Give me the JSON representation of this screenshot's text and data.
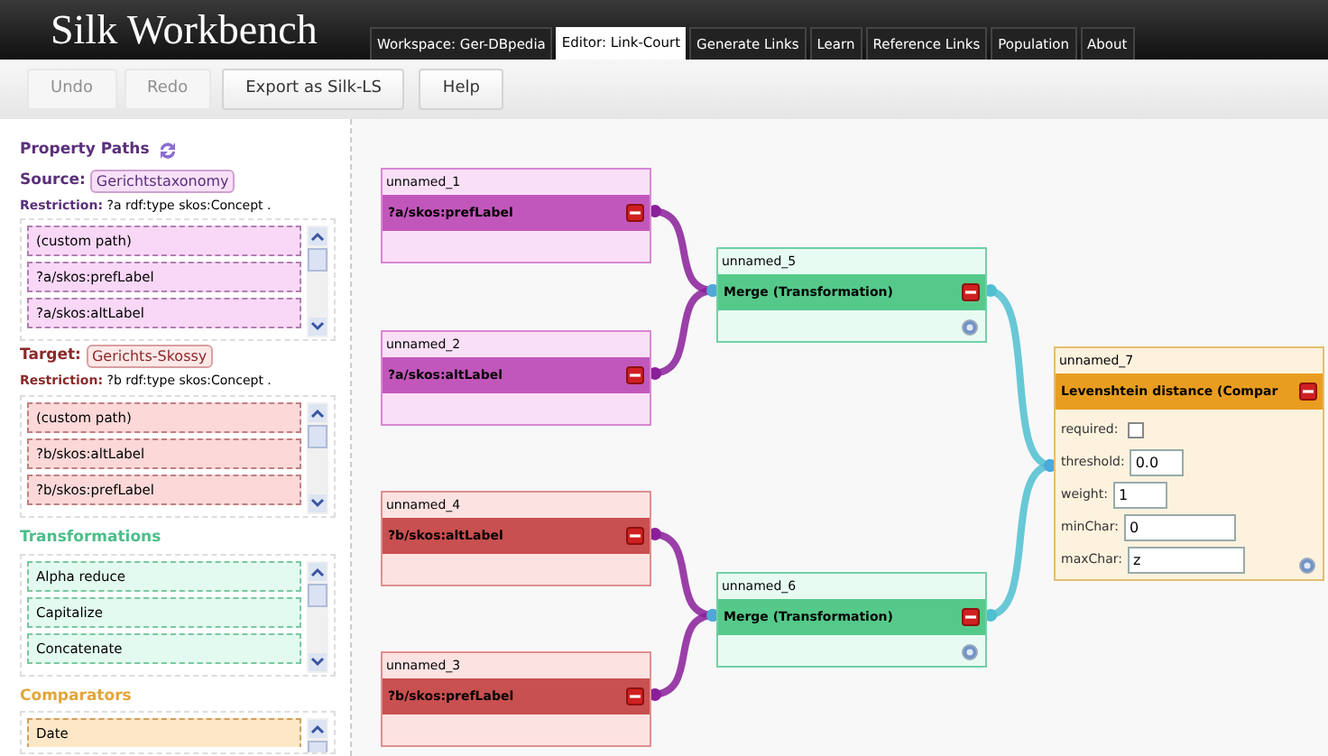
{
  "app_title": "Silk Workbench",
  "tabs": [
    {
      "label": "Workspace: Ger-DBpedia",
      "selected": false
    },
    {
      "label": "Editor: Link-Court",
      "selected": true
    },
    {
      "label": "Generate Links",
      "selected": false
    },
    {
      "label": "Learn",
      "selected": false
    },
    {
      "label": "Reference Links",
      "selected": false
    },
    {
      "label": "Population",
      "selected": false
    },
    {
      "label": "About",
      "selected": false
    }
  ],
  "toolbar": [
    {
      "label": "Undo",
      "disabled": true
    },
    {
      "label": "Redo",
      "disabled": true
    },
    {
      "label": "Export as Silk-LS",
      "disabled": false
    },
    {
      "label": "Help",
      "disabled": false
    }
  ],
  "sidebar": {
    "heading": "Property Paths",
    "sections": [
      {
        "kind": "source",
        "label": "Source:",
        "dataset": "Gerichtstaxonomy",
        "restriction": "**Restriction:** ?a rdf:type skos:Concept .",
        "items": [
          "(custom path)",
          "?a/skos:prefLabel",
          "?a/skos:altLabel"
        ]
      },
      {
        "kind": "target",
        "label": "Target:",
        "dataset": "Gerichts-Skossy",
        "restriction": "**Restriction:** ?b rdf:type skos:Concept .",
        "items": [
          "(custom path)",
          "?b/skos:altLabel",
          "?b/skos:prefLabel"
        ]
      },
      {
        "kind": "transformation",
        "label": "Transformations",
        "items": [
          "Alpha reduce",
          "Capitalize",
          "Concatenate"
        ]
      },
      {
        "kind": "comparator",
        "label": "Comparators",
        "items": [
          "Date"
        ]
      }
    ]
  },
  "canvas": {
    "nodes": [
      {
        "kind": "source",
        "name": "unnamed_1",
        "label": "?a/skos:prefLabel"
      },
      {
        "kind": "source",
        "name": "unnamed_2",
        "label": "?a/skos:altLabel"
      },
      {
        "kind": "transformation",
        "name": "unnamed_5",
        "label": "Merge (Transformation)"
      },
      {
        "kind": "target",
        "name": "unnamed_4",
        "label": "?b/skos:altLabel"
      },
      {
        "kind": "target",
        "name": "unnamed_3",
        "label": "?b/skos:prefLabel"
      },
      {
        "kind": "transformation",
        "name": "unnamed_6",
        "label": "Merge (Transformation)"
      },
      {
        "kind": "comparator",
        "name": "unnamed_7",
        "label": "Levenshtein distance (Compar",
        "params": [
          {
            "kind": "checkbox",
            "label": "required:",
            "checked": false
          },
          {
            "kind": "text",
            "label": "threshold:",
            "value": "0.0"
          },
          {
            "kind": "text",
            "label": "weight:",
            "value": "1"
          },
          {
            "kind": "text",
            "label": "minChar:",
            "value": "0"
          },
          {
            "kind": "text",
            "label": "maxChar:",
            "value": "z"
          }
        ]
      }
    ]
  }
}
